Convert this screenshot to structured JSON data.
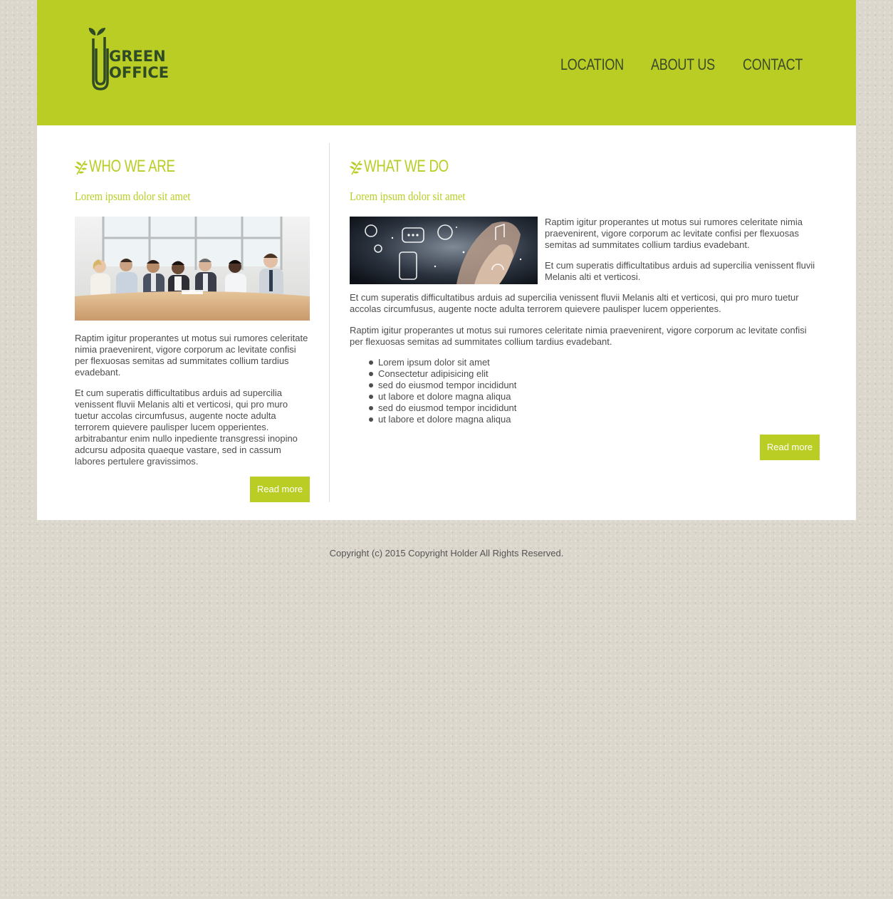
{
  "header": {
    "logo_line1": "GREEN",
    "logo_line2": "OFFICE",
    "nav": [
      "LOCATION",
      "ABOUT US",
      "CONTACT"
    ]
  },
  "left": {
    "title": "WHO WE ARE",
    "subtitle": "Lorem ipsum dolor sit amet",
    "paragraph1": "Raptim igitur properantes ut motus sui rumores celeritate nimia praevenirent, vigore corporum ac levitate confisi per flexuosas semitas ad summitates collium tardius evadebant.",
    "paragraph2": "Et cum superatis difficultatibus arduis ad supercilia venissent fluvii Melanis alti et verticosi, qui pro muro tuetur accolas circumfusus, augente nocte adulta terrorem quievere paulisper lucem opperientes. arbitrabantur enim nullo inpediente transgressi inopino adcursu adposita quaeque vastare, sed in cassum labores pertulere gravissimos.",
    "button": "Read more"
  },
  "right": {
    "title": "WHAT WE DO",
    "subtitle": "Lorem ipsum dolor sit amet",
    "side_paragraph1": "Raptim igitur properantes ut motus sui rumores celeritate nimia praevenirent, vigore corporum ac levitate confisi per flexuosas semitas ad summitates collium tardius evadebant.",
    "side_paragraph2": "Et cum superatis difficultatibus arduis ad supercilia venissent fluvii Melanis alti et verticosi.",
    "paragraph3": "Et cum superatis difficultatibus arduis ad supercilia venissent fluvii Melanis alti et verticosi, qui pro muro tuetur accolas circumfusus, augente nocte adulta terrorem quievere paulisper lucem opperientes.",
    "paragraph4": "Raptim igitur properantes ut motus sui rumores celeritate nimia praevenirent, vigore corporum ac levitate confisi per flexuosas semitas ad summitates collium tardius evadebant.",
    "bullets": [
      "Lorem ipsum dolor sit amet",
      "Consectetur adipisicing elit",
      "sed do eiusmod tempor incididunt",
      "ut labore et dolore magna aliqua",
      "sed do eiusmod tempor incididunt",
      "ut labore et dolore magna aliqua"
    ],
    "button": "Read more"
  },
  "footer": {
    "copyright": "Copyright (c) 2015 Copyright Holder All Rights Reserved."
  },
  "colors": {
    "accent": "#bacd24",
    "dark_green": "#2f4a26",
    "background": "#dcd7cd"
  }
}
